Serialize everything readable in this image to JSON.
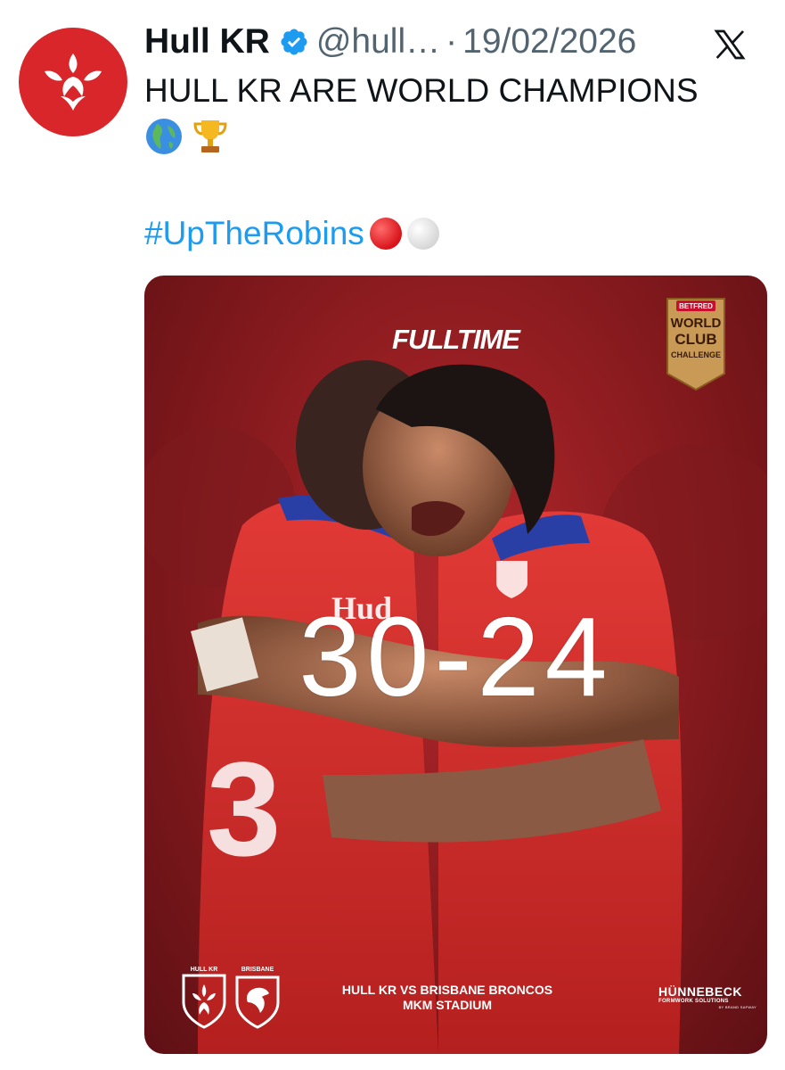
{
  "tweet": {
    "author_name": "Hull KR",
    "handle": "@hull…",
    "separator": "·",
    "date": "19/02/2026",
    "text": "HULL KR ARE WORLD CHAMPIONS",
    "emojis": [
      "globe-europe-africa",
      "trophy"
    ],
    "hashtag": "#UpTheRobins",
    "hashtag_emojis": [
      "red-circle",
      "white-circle"
    ]
  },
  "media": {
    "title": "FULLTIME",
    "score": "30-24",
    "fixture_line": "HULL KR VS BRISBANE BRONCOS",
    "venue_line": "MKM STADIUM",
    "badge": {
      "sponsor": "BETFRED",
      "line1": "WORLD",
      "line2": "CLUB",
      "line3": "CHALLENGE"
    },
    "crest_left_label": "HULL KR",
    "crest_right_label": "BRISBANE",
    "sponsor_name": "HÜNNEBECK",
    "sponsor_sub": "FORMWORK SOLUTIONS",
    "sponsor_tag": "BY BRAND SAFWAY"
  },
  "colors": {
    "brand_red": "#d8262b",
    "link_blue": "#1d9bf0",
    "muted_text": "#536471"
  }
}
